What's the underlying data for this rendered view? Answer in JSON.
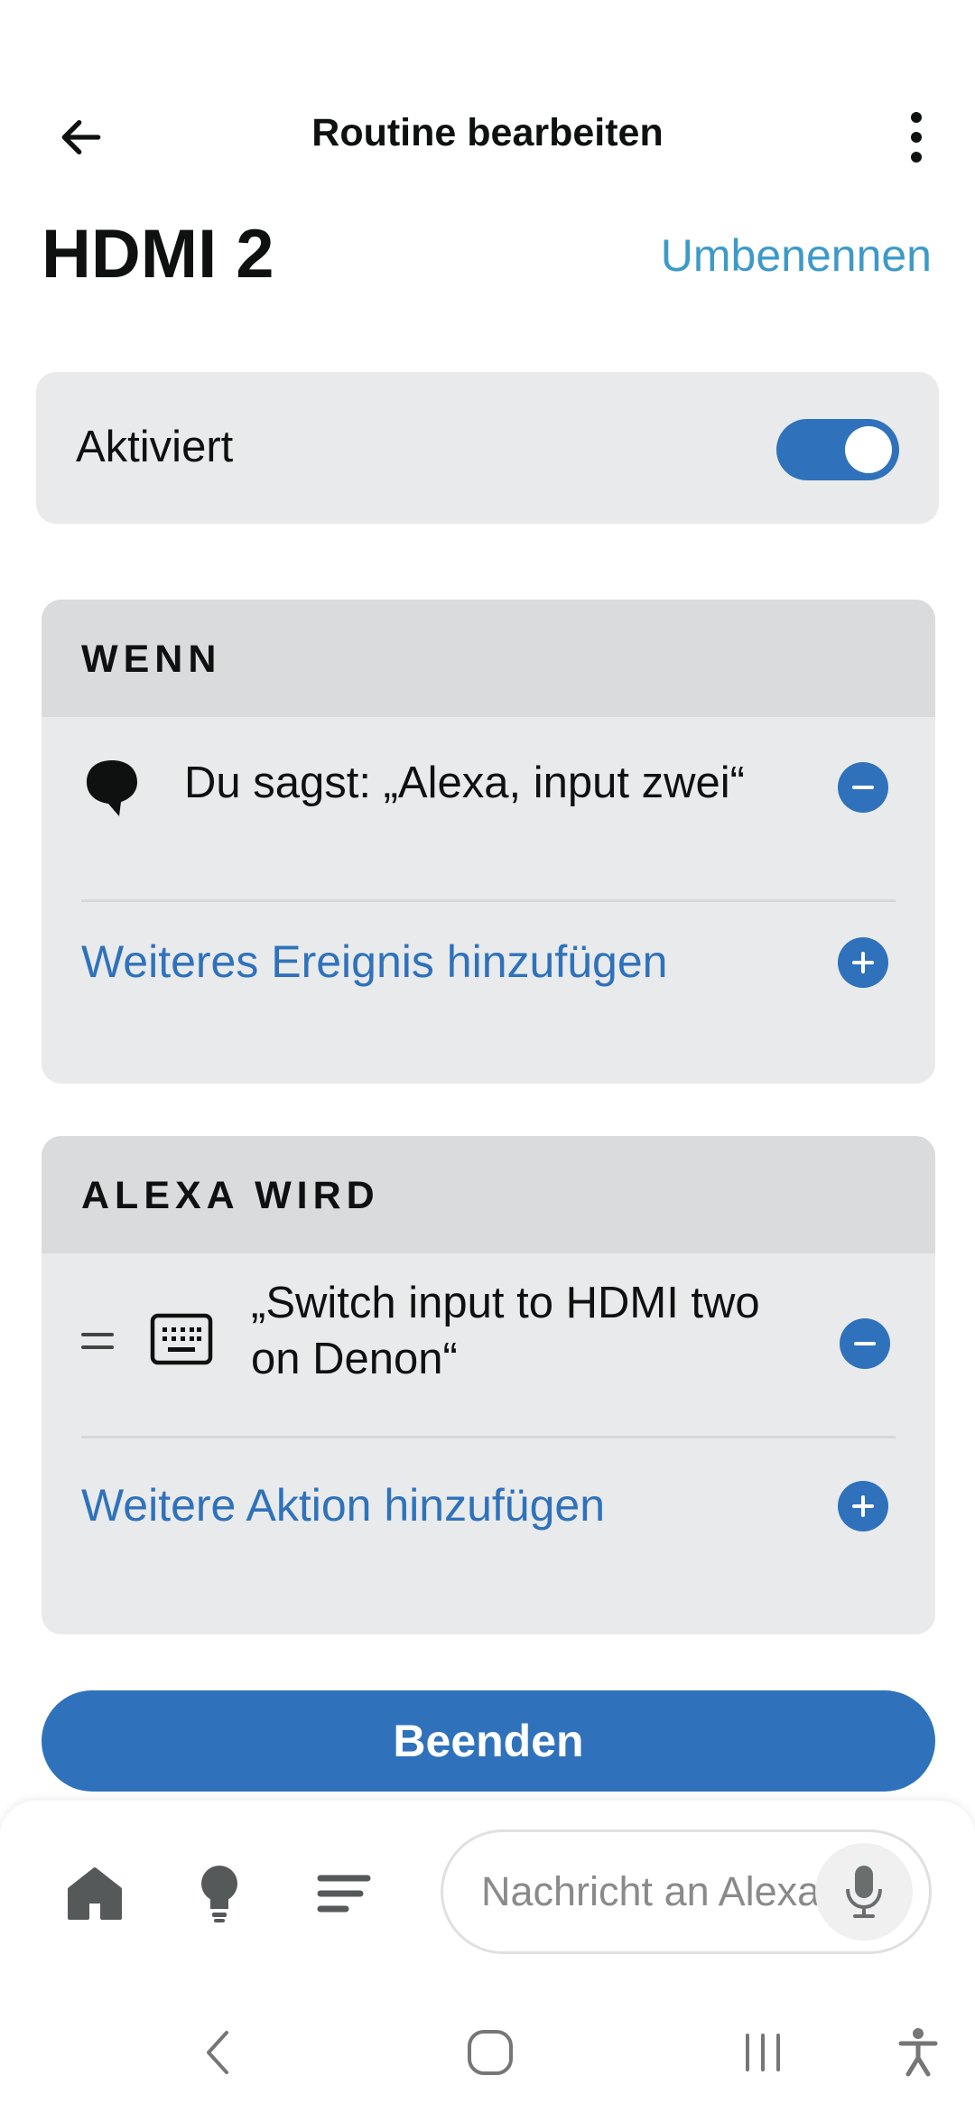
{
  "header": {
    "title": "Routine bearbeiten",
    "back_icon": "arrow-left-icon",
    "menu_icon": "more-vertical-icon"
  },
  "routine": {
    "name": "HDMI 2",
    "rename_label": "Umbenennen"
  },
  "enabled": {
    "label": "Aktiviert",
    "toggle_on": true
  },
  "when_section": {
    "heading": "WENN",
    "trigger_text": "Du sagst: „Alexa, input zwei“",
    "trigger_icon": "speech-bubble-icon",
    "add_label": "Weiteres Ereignis hinzufügen"
  },
  "action_section": {
    "heading": "ALEXA WIRD",
    "action_line1": "„Switch input to HDMI two",
    "action_line2": "on Denon“",
    "action_icon": "keyboard-icon",
    "drag_icon": "drag-handle-icon",
    "add_label": "Weitere Aktion hinzufügen"
  },
  "finish_button": {
    "label": "Beenden"
  },
  "bottom_bar": {
    "icons": [
      "home-icon",
      "lightbulb-icon",
      "menu-lines-icon"
    ],
    "chat_placeholder": "Nachricht an Alexa",
    "mic_icon": "microphone-icon"
  },
  "system_nav": {
    "icons": [
      "back-icon",
      "home-circle-icon",
      "recents-icon",
      "accessibility-icon"
    ]
  },
  "colors": {
    "accent": "#2f72bb",
    "link": "#3d9ac8",
    "card": "#e9eaeb",
    "card_header": "#dadbdd"
  }
}
